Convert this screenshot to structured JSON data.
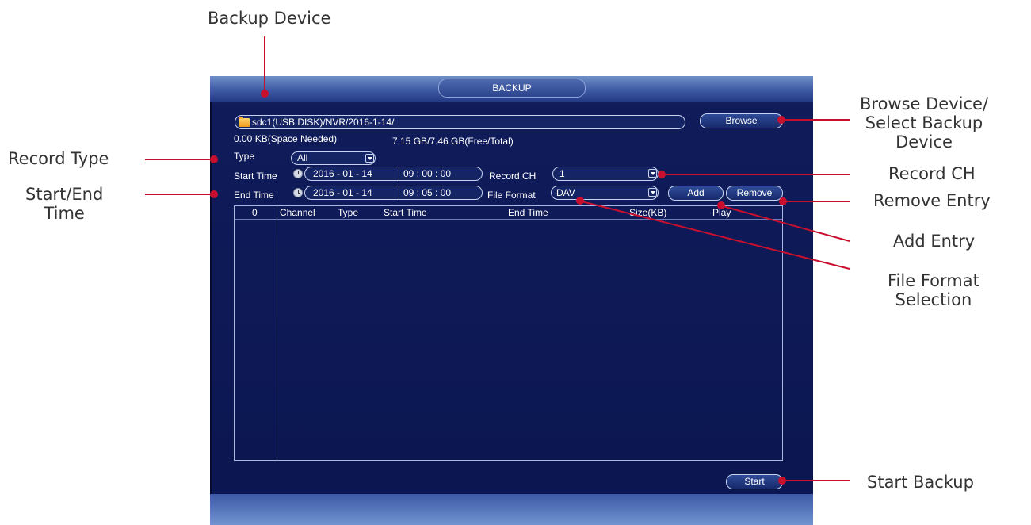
{
  "annotations": {
    "backup_device": "Backup Device",
    "browse_device": [
      "Browse Device/",
      "Select Backup",
      "Device"
    ],
    "record_type": "Record Type",
    "start_end_time": [
      "Start/End",
      "Time"
    ],
    "record_ch": "Record CH",
    "remove_entry": "Remove Entry",
    "add_entry": "Add Entry",
    "file_format": [
      "File Format",
      "Selection"
    ],
    "start_backup": "Start Backup"
  },
  "window": {
    "title": "BACKUP",
    "device_path": "sdc1(USB DISK)/NVR/2016-1-14/",
    "browse_label": "Browse",
    "space_needed": "0.00 KB(Space Needed)",
    "free_total": "7.15 GB/7.46 GB(Free/Total)",
    "type_label": "Type",
    "type_value": "All",
    "start_time_label": "Start Time",
    "start_date": "2016 - 01 - 14",
    "start_clock": "09 : 00 : 00",
    "end_time_label": "End Time",
    "end_date": "2016 - 01 - 14",
    "end_clock": "09 : 05 : 00",
    "record_ch_label": "Record CH",
    "record_ch_value": "1",
    "file_format_label": "File Format",
    "file_format_value": "DAV",
    "add_label": "Add",
    "remove_label": "Remove",
    "start_label": "Start"
  },
  "table": {
    "columns": [
      "0",
      "Channel",
      "Type",
      "Start Time",
      "End Time",
      "Size(KB)",
      "Play"
    ],
    "rows": []
  },
  "colors": {
    "annotation_line": "#c8102e",
    "window_bg": "#0b1650",
    "title_bar": "#3e5ba3"
  }
}
